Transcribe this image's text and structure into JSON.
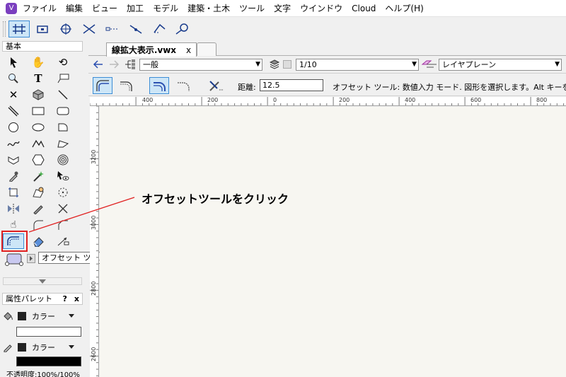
{
  "menu": {
    "app_icon": "vectorworks-app-icon",
    "items": [
      "ファイル",
      "編集",
      "ビュー",
      "加工",
      "モデル",
      "建築・土木",
      "ツール",
      "文字",
      "ウインドウ",
      "Cloud",
      "ヘルプ(H)"
    ]
  },
  "palette": {
    "title": "基本"
  },
  "document": {
    "tab_label": "線拡大表示.vwx",
    "tab_close": "x"
  },
  "viewbar": {
    "class_value": "一般",
    "scale_value": "1/10",
    "layer_value": "レイヤプレーン"
  },
  "modebar": {
    "distance_label": "距離:",
    "distance_value": "12.5",
    "help_text": "オフセット ツール: 数値入力 モード. 図形を選択します。Alt キーを使用"
  },
  "ruler": {
    "top_ticks": [
      "400",
      "200",
      "0",
      "200",
      "400",
      "600",
      "800"
    ],
    "left_ticks": [
      "3200",
      "3000",
      "2800",
      "2600"
    ]
  },
  "tooltip": {
    "text": "オフセット ツール (Shift+-)"
  },
  "annotation": {
    "text": "オフセットツールをクリック",
    "color": "#e02020"
  },
  "attributes": {
    "title": "属性パレット",
    "help": "?",
    "close": "x",
    "fill_label": "カラー",
    "pen_label": "カラー",
    "opacity": "不透明度:100%/100%"
  }
}
